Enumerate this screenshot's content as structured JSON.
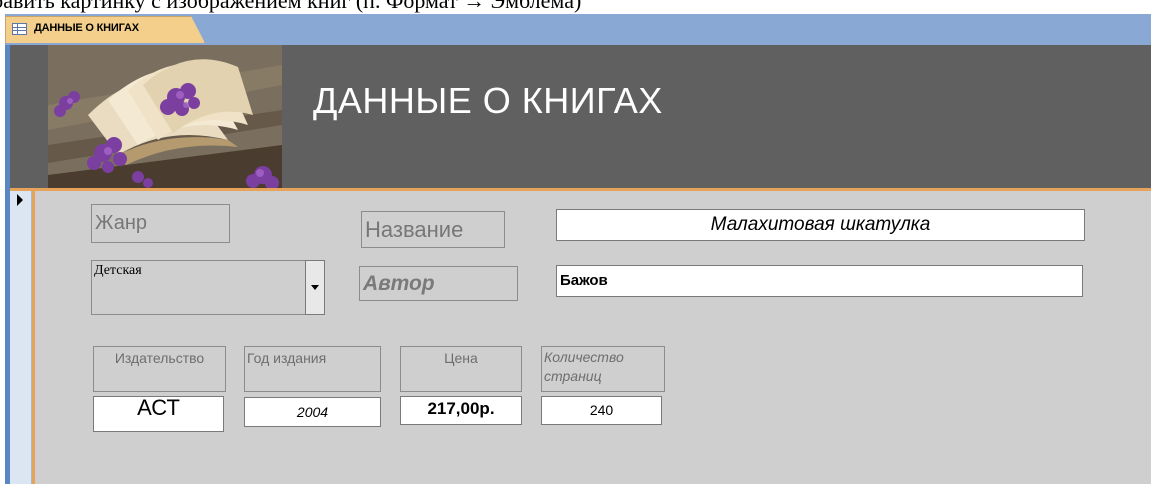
{
  "page_caption": "бавить картинку с изображением книг (п. Формат → Эмблема)",
  "tab": {
    "label": "ДАННЫЕ О КНИГАХ",
    "icon": "form-icon"
  },
  "header": {
    "title": "ДАННЫЕ О КНИГАХ",
    "image": "book-with-lilac-photo"
  },
  "form": {
    "genre_label": "Жанр",
    "genre_value": "Детская",
    "title_label": "Название",
    "title_value": "Малахитовая шкатулка",
    "author_label": "Автор",
    "author_value": "Бажов",
    "publisher_label": "Издательство",
    "publisher_value": "АСТ",
    "year_label": "Год издания",
    "year_value": "2004",
    "price_label": "Цена",
    "price_value": "217,00р.",
    "pages_label": "Количество страниц",
    "pages_value": "240"
  },
  "colors": {
    "tabbar": "#8aa8d4",
    "header": "#606060",
    "detail": "#cfcfcf",
    "accent": "#e7a35a"
  }
}
